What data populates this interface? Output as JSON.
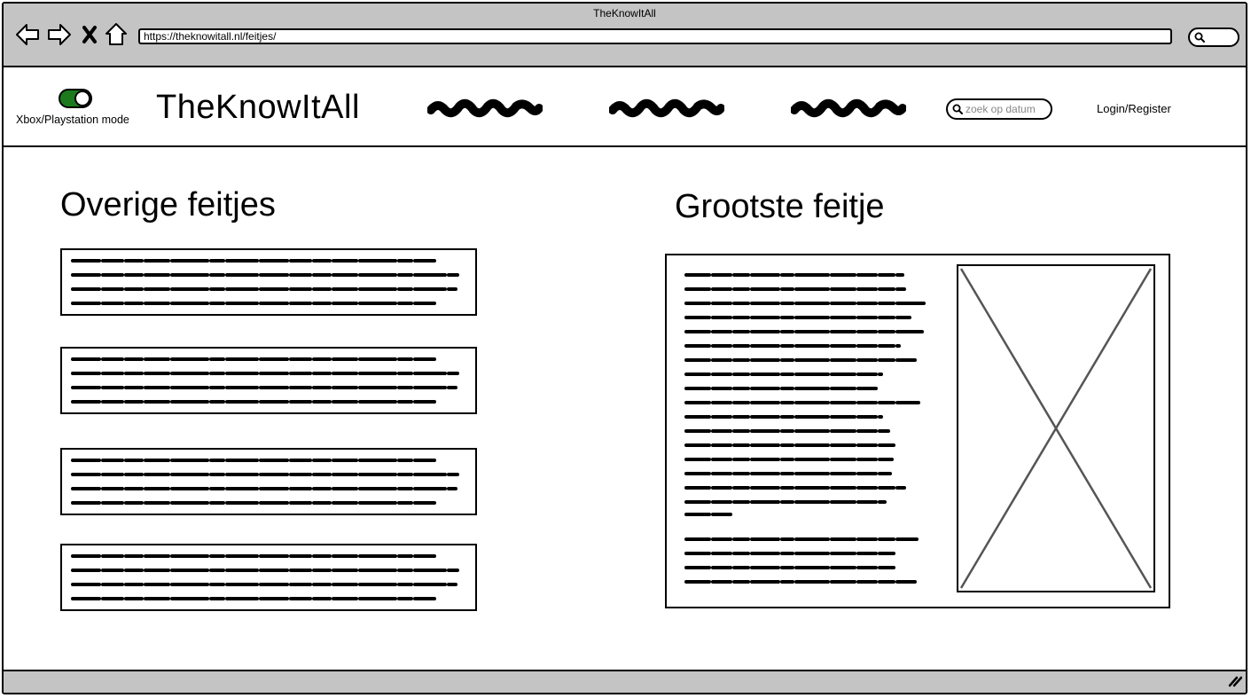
{
  "browser": {
    "window_title": "TheKnowItAll",
    "url": "https://theknowitall.nl/feitjes/"
  },
  "header": {
    "mode_label": "Xbox/Playstation mode",
    "mode_enabled": true,
    "logo": "TheKnowItAll",
    "search_placeholder": "zoek op datum",
    "login_label": "Login/Register"
  },
  "sections": {
    "other_facts_title": "Overige feitjes",
    "main_fact_title": "Grootste feitje"
  },
  "colors": {
    "chrome": "#c4c4c4",
    "toggle_on": "#1c7a1c",
    "placeholder_text": "#888888"
  },
  "icons": [
    "back-arrow-icon",
    "forward-arrow-icon",
    "close-icon",
    "home-icon",
    "search-icon",
    "resize-grip-icon",
    "image-placeholder-icon"
  ]
}
